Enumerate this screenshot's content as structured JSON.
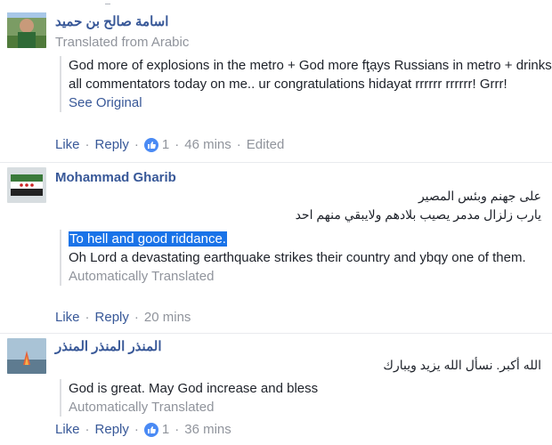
{
  "comments": [
    {
      "author": "اسامة صالح بن حميد",
      "translated_from": "Translated from Arabic",
      "text": "God more of explosions in the metro + God more fţạys Russians in metro + drinks all commentators today on me.. ur congratulations hidayat rrrrrr rrrrrr! Grrr!",
      "see_original": "See Original",
      "actions": {
        "like": "Like",
        "reply": "Reply",
        "reactions": "1",
        "time": "46 mins",
        "edited": "Edited"
      }
    },
    {
      "author": "Mohammad Gharib",
      "original_lines": [
        "على جهنم وبئس المصير",
        "يارب زلزال مدمر يصيب بلادهم ولايبقي منهم احد"
      ],
      "translation_highlight": "To hell and good riddance.",
      "translation_body": "Oh Lord a devastating earthquake strikes their country and ybqy one of them.",
      "auto_translated": "Automatically Translated",
      "actions": {
        "like": "Like",
        "reply": "Reply",
        "time": "20 mins"
      }
    },
    {
      "author": "المنذر المنذر المنذر",
      "original_lines": [
        "الله أكبر. نسأل الله يزيد ويبارك"
      ],
      "translation_body": "God is great. May God increase and bless",
      "auto_translated": "Automatically Translated",
      "actions": {
        "like": "Like",
        "reply": "Reply",
        "reactions": "1",
        "time": "36 mins"
      }
    }
  ],
  "icons": {
    "like_reaction": "thumbs-up-icon"
  },
  "colors": {
    "link": "#385898",
    "meta": "#90949c",
    "reaction": "#4a8af4",
    "highlight": "#1a73e8"
  }
}
